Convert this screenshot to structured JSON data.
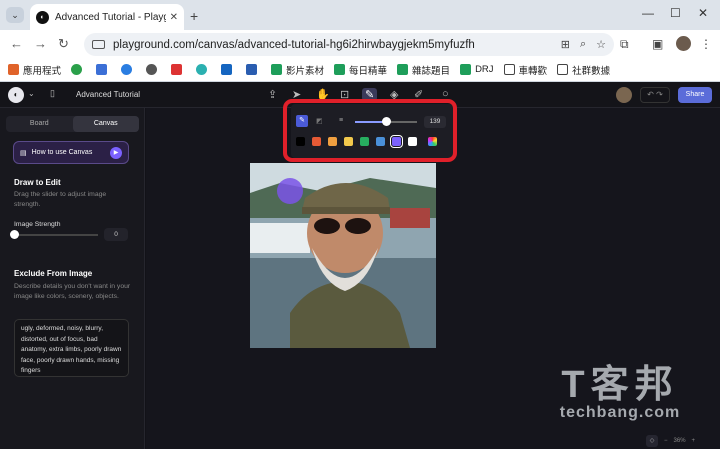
{
  "browser": {
    "tab_title": "Advanced Tutorial - Playgrour",
    "url": "playground.com/canvas/advanced-tutorial-hg6i2hirwbaygjekm5myfuzfh",
    "bookmarks": [
      "應用程式",
      "",
      "",
      "",
      "",
      "",
      "",
      "影片素材",
      "每日精華",
      "雜誌題目",
      "DRJ",
      "車轉歡",
      "社群數據"
    ]
  },
  "app": {
    "project_title": "Advanced Tutorial",
    "share_label": "Share",
    "tabs": [
      "Board",
      "Canvas"
    ],
    "active_tab": "Canvas",
    "howto_label": "How to use Canvas",
    "draw_heading": "Draw to Edit",
    "draw_desc": "Drag the slider to adjust image strength.",
    "strength_label": "Image Strength",
    "strength_value": "0",
    "exclude_heading": "Exclude From Image",
    "exclude_desc": "Describe details you don't want in your image like colors, scenery, objects.",
    "exclude_text": "ugly, deformed, noisy, blurry, distorted, out of focus, bad anatomy, extra limbs, poorly drawn face, poorly drawn hands, missing fingers",
    "brush_size": "139",
    "brush_level": 0.5,
    "colors": [
      "#000000",
      "#e65a35",
      "#f0a040",
      "#f2c94c",
      "#27ae60",
      "#4a90d9",
      "#7b61ff",
      "#ffffff"
    ],
    "selected_color_index": 6,
    "zoom": "36%"
  },
  "watermark": {
    "big": "T客邦",
    "small": "techbang.com"
  }
}
